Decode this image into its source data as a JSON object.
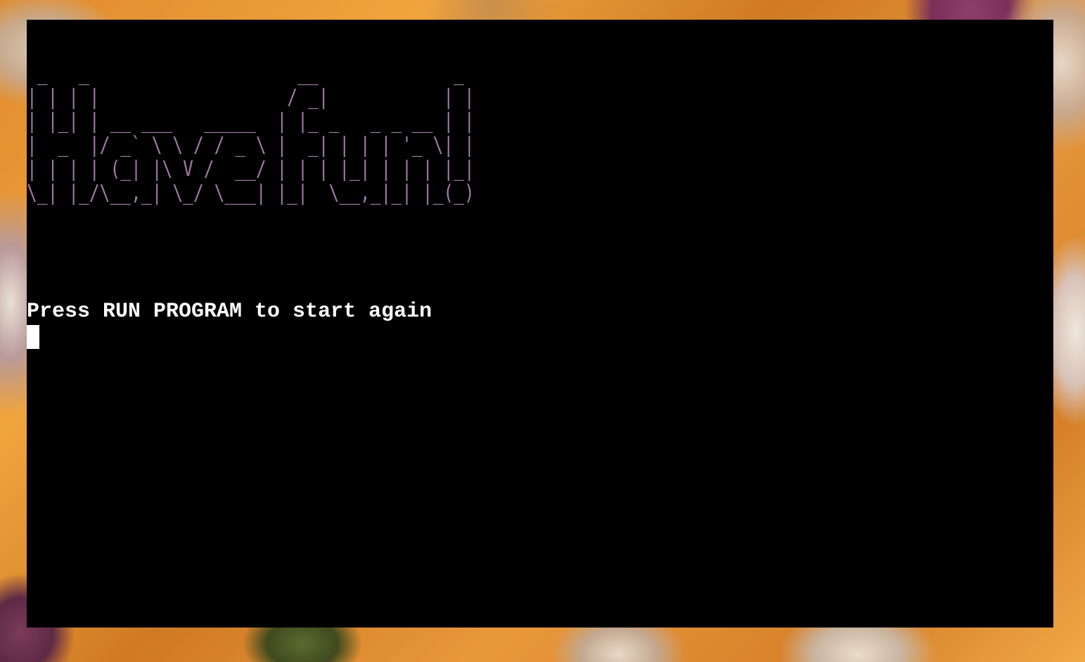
{
  "terminal": {
    "banner_art": " _   _                    __             _ \n| | | |                  / _|           | |\n| |_| | __ ___   _____  | |_ _   _ _ __ | |\n|  _  |/ _` \\ \\ / / _ \\ |  _| | | | '_ \\| |\n| | | | (_| |\\ V /  __/ | | | |_| | | | |_|\n\\_| |_/\\__,_| \\_/ \\___| |_|  \\__,_|_| |_(_)",
    "message": "Press RUN PROGRAM to start again"
  },
  "colors": {
    "terminal_background": "#000000",
    "banner_text": "#a07aa7",
    "message_text": "#ffffff",
    "cursor": "#ffffff"
  }
}
